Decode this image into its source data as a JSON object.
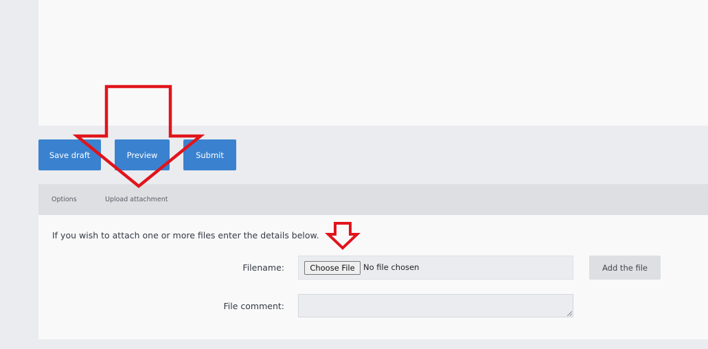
{
  "actions": {
    "save_draft": "Save draft",
    "preview": "Preview",
    "submit": "Submit"
  },
  "tabs": [
    {
      "label": "Options"
    },
    {
      "label": "Upload attachment"
    }
  ],
  "panel": {
    "intro": "If you wish to attach one or more files enter the details below.",
    "filename_label": "Filename:",
    "choose_file": "Choose File",
    "no_file": "No file chosen",
    "add_file": "Add the file",
    "comment_label": "File comment:",
    "comment_value": ""
  },
  "colors": {
    "primary_button": "#3a82cf",
    "annotation_arrow": "#e0141c"
  }
}
